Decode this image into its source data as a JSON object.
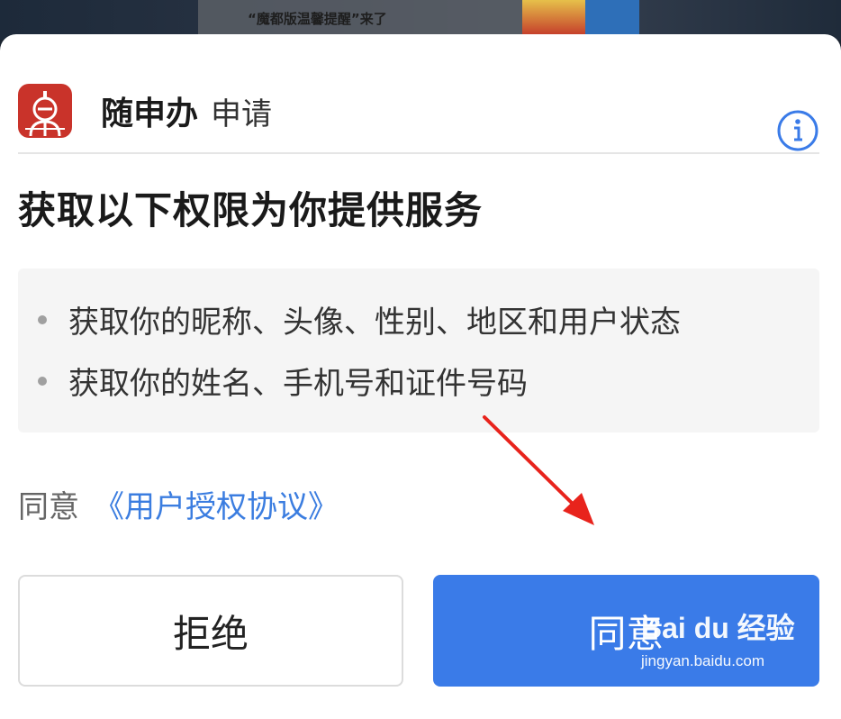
{
  "background": {
    "banner_text": "“魔都版温馨提醒”来了"
  },
  "dialog": {
    "app_name": "随申办",
    "app_action": "申请",
    "title": "获取以下权限为你提供服务",
    "permissions": [
      "获取你的昵称、头像、性别、地区和用户状态",
      "获取你的姓名、手机号和证件号码"
    ],
    "agree_prefix": "同意",
    "agreement_link": "《用户授权协议》",
    "reject_label": "拒绝",
    "accept_label": "同意"
  },
  "watermark": {
    "brand": "Bai du 经验",
    "url": "jingyan.baidu.com"
  },
  "colors": {
    "accent": "#3a7be8",
    "link": "#3b7de0",
    "logo_bg": "#c9332a",
    "annotation_arrow": "#e8231c"
  },
  "icons": {
    "app_logo": "app-logo-icon",
    "info": "info-icon",
    "arrow": "red-arrow-annotation"
  }
}
